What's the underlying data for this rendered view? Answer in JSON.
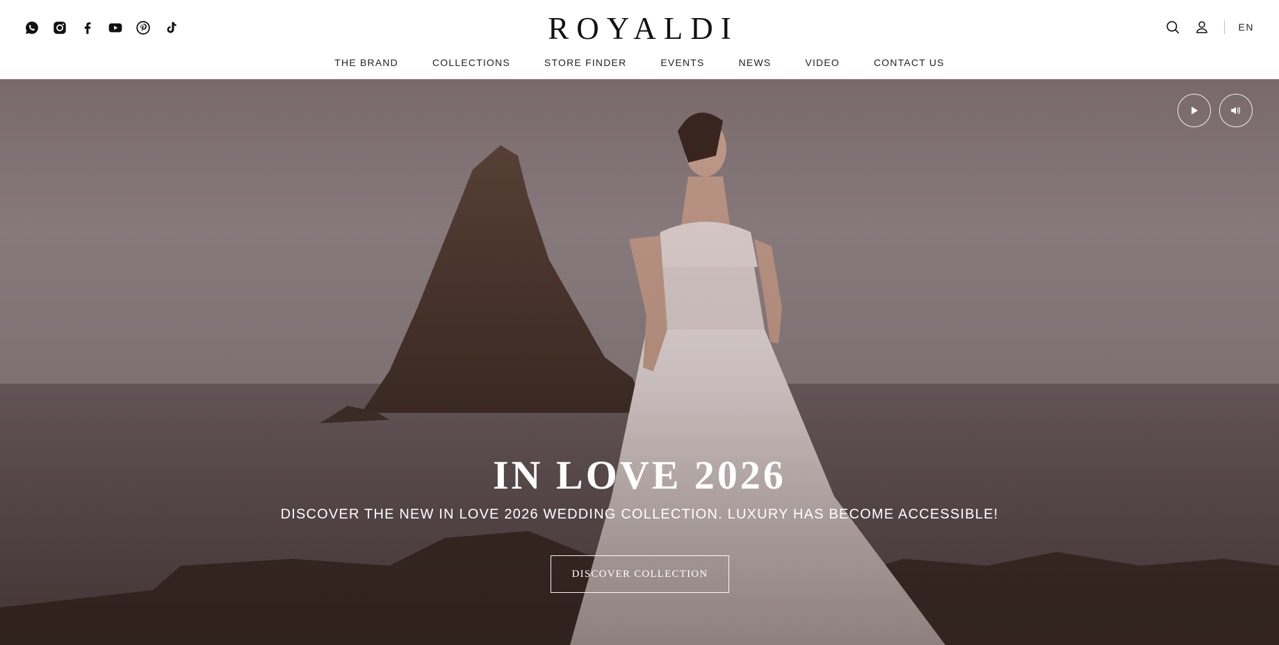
{
  "header": {
    "logo": "ROYALDI",
    "social": [
      {
        "icon": "whatsapp-icon"
      },
      {
        "icon": "instagram-icon"
      },
      {
        "icon": "facebook-icon"
      },
      {
        "icon": "youtube-icon"
      },
      {
        "icon": "pinterest-icon"
      },
      {
        "icon": "tiktok-icon"
      }
    ],
    "tools": {
      "search_icon": "search-icon",
      "account_icon": "user-icon",
      "language": "EN"
    },
    "nav": [
      {
        "label": "THE BRAND"
      },
      {
        "label": "COLLECTIONS"
      },
      {
        "label": "STORE FINDER"
      },
      {
        "label": "EVENTS"
      },
      {
        "label": "NEWS"
      },
      {
        "label": "VIDEO"
      },
      {
        "label": "CONTACT US"
      }
    ]
  },
  "hero": {
    "title": "IN LOVE 2026",
    "subtitle": "DISCOVER THE NEW IN LOVE 2026 WEDDING COLLECTION. LUXURY HAS BECOME ACCESSIBLE!",
    "cta": "DISCOVER COLLECTION",
    "controls": {
      "play_icon": "play-icon",
      "sound_icon": "volume-icon"
    }
  },
  "colors": {
    "header_bg": "#ffffff",
    "text": "#111111",
    "hero_text": "#ffffff",
    "hero_tint": "#8a7c7e"
  }
}
